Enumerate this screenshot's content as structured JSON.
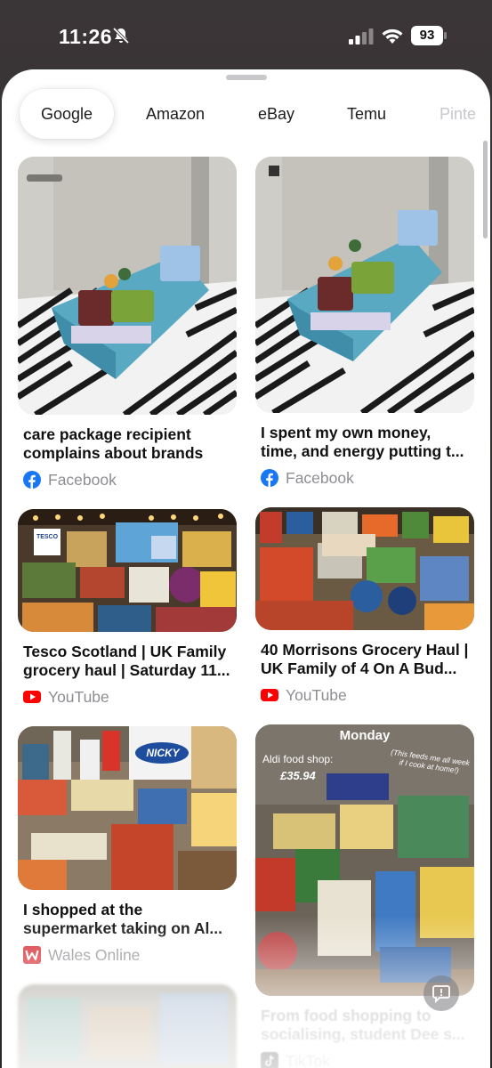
{
  "status_bar": {
    "time": "11:26",
    "battery": "93",
    "icons": [
      "bell-slash-icon",
      "signal-icon",
      "wifi-icon",
      "battery-icon"
    ]
  },
  "tabs": [
    {
      "label": "Google",
      "active": true
    },
    {
      "label": "Amazon",
      "active": false
    },
    {
      "label": "eBay",
      "active": false
    },
    {
      "label": "Temu",
      "active": false
    },
    {
      "label": "Pinte",
      "active": false
    }
  ],
  "results": [
    {
      "title": "care package recipient complains about brands",
      "source": "Facebook",
      "source_icon": "facebook-icon"
    },
    {
      "title": "I spent my own money, time, and energy putting t...",
      "source": "Facebook",
      "source_icon": "facebook-icon"
    },
    {
      "title": "Tesco Scotland | UK Family grocery haul | Saturday 11...",
      "source": "YouTube",
      "source_icon": "youtube-icon"
    },
    {
      "title": "40 Morrisons Grocery Haul | UK Family of 4 On A Bud...",
      "source": "YouTube",
      "source_icon": "youtube-icon"
    },
    {
      "title": "I shopped at the supermarket taking on Al...",
      "source": "Wales Online",
      "source_icon": "wales-online-icon"
    },
    {
      "title": "From food shopping to socialising, student Dee s...",
      "source": "TikTok",
      "source_icon": "tiktok-icon"
    }
  ],
  "image_text": {
    "tesco_logo": "TESCO",
    "nicky_logo": "NICKY",
    "monday_label": "Monday",
    "aldi_label": "Aldi food shop:",
    "aldi_price": "£35.94",
    "aldi_note": "(This feeds me all week if I cook at home!)"
  },
  "colors": {
    "accent_facebook": "#1877f2",
    "accent_youtube": "#ff0000",
    "accent_wales_online": "#d7282f",
    "source_text": "#8e8e93"
  },
  "feedback_icon": "feedback-icon"
}
